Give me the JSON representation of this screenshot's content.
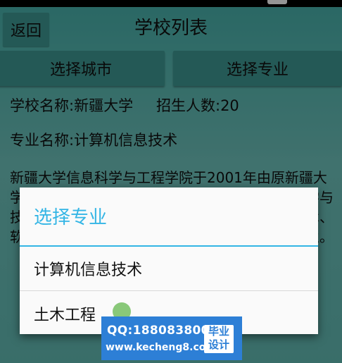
{
  "header": {
    "back_label": "返回",
    "title": "学校列表"
  },
  "toolbar": {
    "city_button": "选择城市",
    "major_button": "选择专业"
  },
  "school": {
    "name_line": "学校名称:新疆大学",
    "enroll_line": "招生人数:20",
    "major_line": "专业名称:计算机信息技术",
    "description": "新疆大学信息科学与工程学院于2001年由原新疆大学计算机科学系等单位合并组建，设有计算机科学与技术、电子信息工程、通信工程、计算机信息技术、软件工程、电子与信息工程和信息安全等本科专业。"
  },
  "dialog": {
    "title": "选择专业",
    "options": [
      "计算机信息技术",
      "土木工程"
    ]
  },
  "watermark": {
    "qq": "QQ:188083800",
    "url": "www.kecheng8.com",
    "badge_line1": "毕业",
    "badge_line2": "设计"
  },
  "colors": {
    "background": "#63bdb6",
    "button": "#3f9a94",
    "dialog_accent": "#33b5e5",
    "watermark": "#2d7fd6"
  }
}
